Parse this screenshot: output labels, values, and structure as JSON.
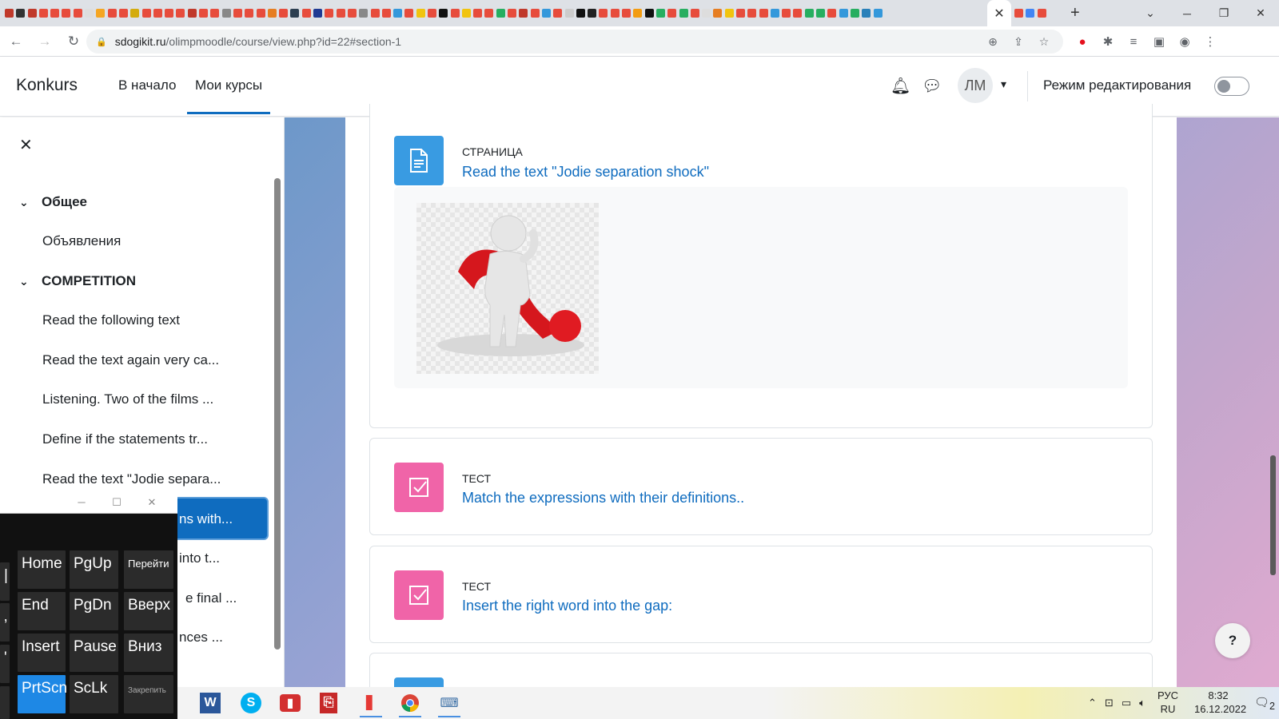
{
  "browser": {
    "tab_colors": [
      "#c0392b",
      "#333",
      "#c0392b",
      "#e74c3c",
      "#e74c3c",
      "#e74c3c",
      "#e74c3c",
      "#ddd",
      "#f5a623",
      "#e74c3c",
      "#e74c3c",
      "#d4ac0d",
      "#e74c3c",
      "#e74c3c",
      "#e74c3c",
      "#e74c3c",
      "#c0392b",
      "#e74c3c",
      "#e74c3c",
      "#888",
      "#e74c3c",
      "#e74c3c",
      "#e74c3c",
      "#e67e22",
      "#e74c3c",
      "#2c3e50",
      "#e74c3c",
      "#1f3a93",
      "#e74c3c",
      "#e74c3c",
      "#e74c3c",
      "#888",
      "#e74c3c",
      "#e74c3c",
      "#3498db",
      "#e74c3c",
      "#f1c40f",
      "#e74c3c",
      "#111",
      "#e74c3c",
      "#f1c40f",
      "#e74c3c",
      "#e74c3c",
      "#27ae60",
      "#e74c3c",
      "#c0392b",
      "#e74c3c",
      "#3498db",
      "#e74c3c",
      "#ccc",
      "#111",
      "#222",
      "#e74c3c",
      "#e74c3c",
      "#e74c3c",
      "#f39c12",
      "#111",
      "#27ae60",
      "#e74c3c",
      "#27ae60",
      "#e74c3c",
      "#ddd",
      "#e67e22",
      "#f1c40f",
      "#e74c3c",
      "#e74c3c",
      "#e74c3c",
      "#3498db",
      "#e74c3c",
      "#e74c3c",
      "#27ae60",
      "#27ae60",
      "#e74c3c",
      "#3498db",
      "#27ae60",
      "#2980b9",
      "#3498db"
    ],
    "tab_colors_after": [
      "#e74c3c",
      "#4285f4",
      "#e74c3c"
    ],
    "active_tab_close": "✕",
    "new_tab": "+",
    "url_host": "sdogikit.ru",
    "url_path": "/olimpmoodle/course/view.php?id=22#section-1"
  },
  "navbar": {
    "brand": "Konkurs",
    "home": "В начало",
    "my_courses": "Мои курсы",
    "avatar_initials": "ЛМ",
    "edit_mode_label": "Режим редактирования"
  },
  "drawer": {
    "sections": [
      {
        "title": "Общее",
        "items": [
          "Объявления"
        ]
      },
      {
        "title": "COMPETITION",
        "items": [
          "Read the following text",
          "Read the text again very ca...",
          "Listening. Two of the films ...",
          "Define if the statements tr...",
          "Read the text \"Jodie separa...",
          "ns with...",
          "into t...",
          "e final ...",
          "nces ..."
        ]
      }
    ]
  },
  "activities": [
    {
      "type": "СТРАНИЦА",
      "title": "Read the text \"Jodie separation shock\""
    },
    {
      "type": "ТЕСТ",
      "title": "Match the expressions with their definitions.."
    },
    {
      "type": "ТЕСТ",
      "title": "Insert the right word into the gap:"
    }
  ],
  "help": "?",
  "keyboard": {
    "rows": [
      [
        "Home",
        "PgUp",
        "Перейти"
      ],
      [
        "End",
        "PgDn",
        "Вверх"
      ],
      [
        "Insert",
        "Pause",
        "Вниз"
      ],
      [
        "PrtScn",
        "ScLk",
        "Закрепить"
      ]
    ]
  },
  "taskbar": {
    "lang_top": "РУС",
    "lang_bottom": "RU",
    "time": "8:32",
    "date": "16.12.2022",
    "notif_count": "2"
  }
}
